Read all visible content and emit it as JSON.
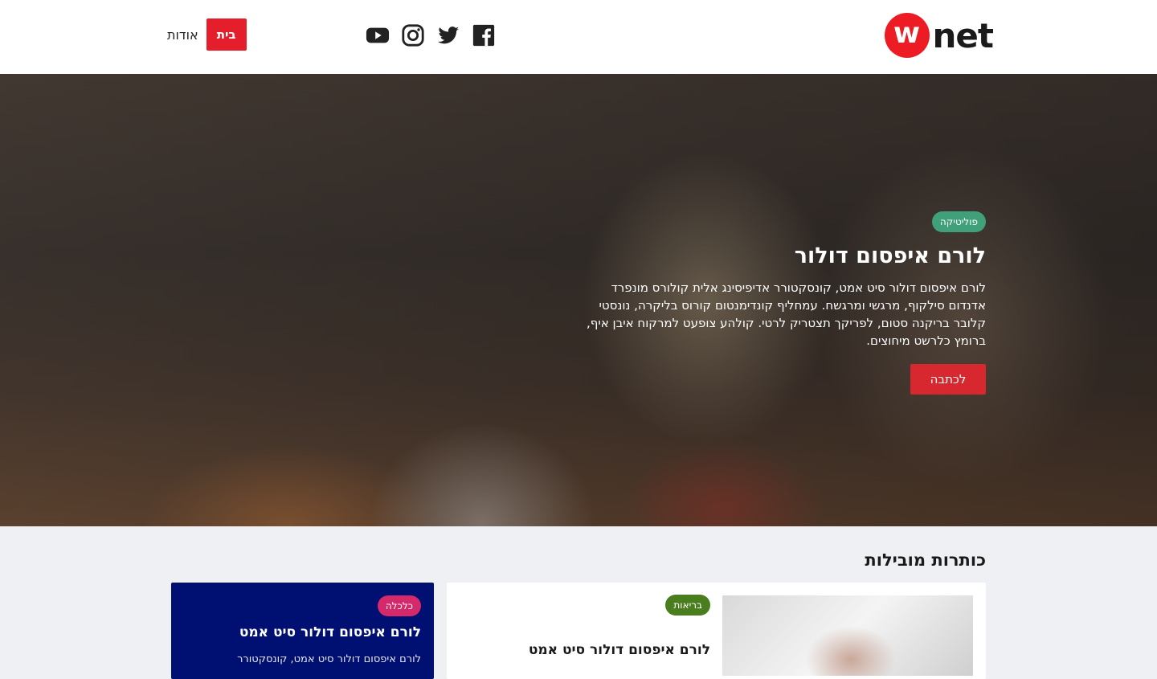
{
  "header": {
    "logo": {
      "mark": "w",
      "text": "net"
    },
    "social": [
      {
        "icon": "facebook-icon"
      },
      {
        "icon": "twitter-icon"
      },
      {
        "icon": "instagram-icon"
      },
      {
        "icon": "youtube-icon"
      }
    ],
    "nav": {
      "home_label": "בית",
      "about_label": "אודות"
    },
    "accent_color": "#e41f2b"
  },
  "hero": {
    "tag": "פוליטיקה",
    "title": "לורם איפסום דולור",
    "text": "לורם איפסום דולור סיט אמט, קונסקטורר אדיפיסינג אלית קולורס מונפרד אדנדום סילקוף, מרגשי ומרגשח. עמחליף קונדימנטום קורוס בליקרה, נונסטי קלובר בריקנה סטום, לפריקך תצטריק לרטי. קולהע צופעט למרקוח איבן איף, ברומץ כלרשט מיחוצים.",
    "button": "לכתבה"
  },
  "headlines": {
    "section_title": "כותרות מובילות",
    "main_card": {
      "tag": "בריאות",
      "title": "לורם איפסום דולור סיט אמט"
    },
    "side_card": {
      "tag": "כלכלה",
      "title": "לורם איפסום דולור סיט אמט",
      "text": "לורם איפסום דולור סיט אמט, קונסקטורר"
    }
  }
}
